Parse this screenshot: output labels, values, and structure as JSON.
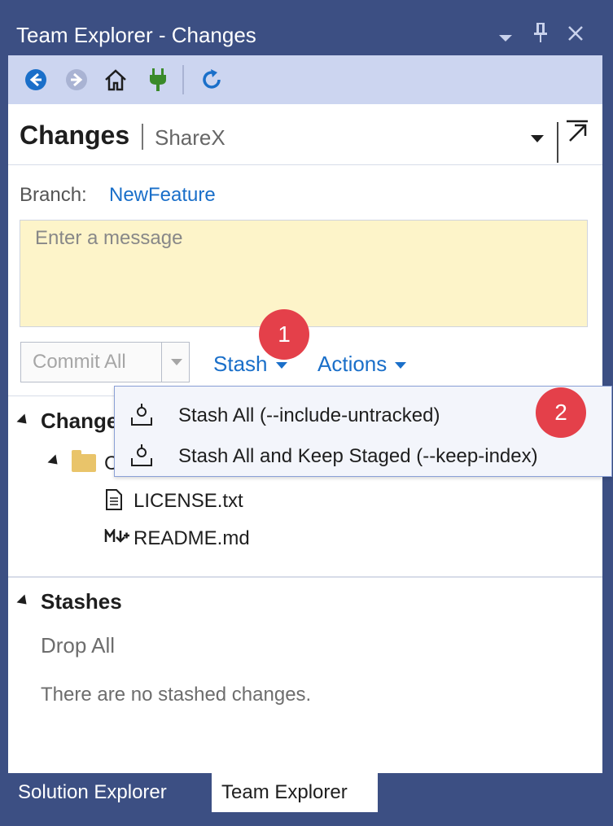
{
  "window": {
    "title": "Team Explorer - Changes",
    "controls": [
      "dropdown-icon",
      "pin-icon",
      "close-icon"
    ]
  },
  "toolbar": {
    "buttons": [
      "back-icon",
      "forward-icon",
      "home-icon",
      "connect-icon",
      "refresh-icon"
    ],
    "colors": {
      "back": "#1a6fc9",
      "forward": "#a9b3d3",
      "connect": "#3a8a2a",
      "refresh": "#1a6fc9"
    }
  },
  "header": {
    "title": "Changes",
    "repo": "ShareX"
  },
  "branch": {
    "label": "Branch:",
    "name": "NewFeature"
  },
  "message": {
    "placeholder": "Enter a message",
    "value": ""
  },
  "actions": {
    "commit_label": "Commit All",
    "stash_label": "Stash",
    "actions_label": "Actions"
  },
  "stash_menu": {
    "items": [
      {
        "label": "Stash All (--include-untracked)"
      },
      {
        "label": "Stash All and Keep Staged (--keep-index)"
      }
    ]
  },
  "changes_section": {
    "title": "Changes",
    "folder_partial": "C",
    "files": [
      {
        "name": "LICENSE.txt",
        "icon": "text-file-icon"
      },
      {
        "name": "README.md",
        "icon": "markdown-file-icon"
      }
    ]
  },
  "stashes_section": {
    "title": "Stashes",
    "drop_all": "Drop All",
    "empty_text": "There are no stashed changes."
  },
  "badges": {
    "one": "1",
    "two": "2",
    "color": "#e4404a"
  },
  "tabs": [
    {
      "label": "Solution Explorer",
      "active": false
    },
    {
      "label": "Team Explorer",
      "active": true
    }
  ],
  "accent": "#1a6fc9",
  "chrome": "#3c4f83"
}
